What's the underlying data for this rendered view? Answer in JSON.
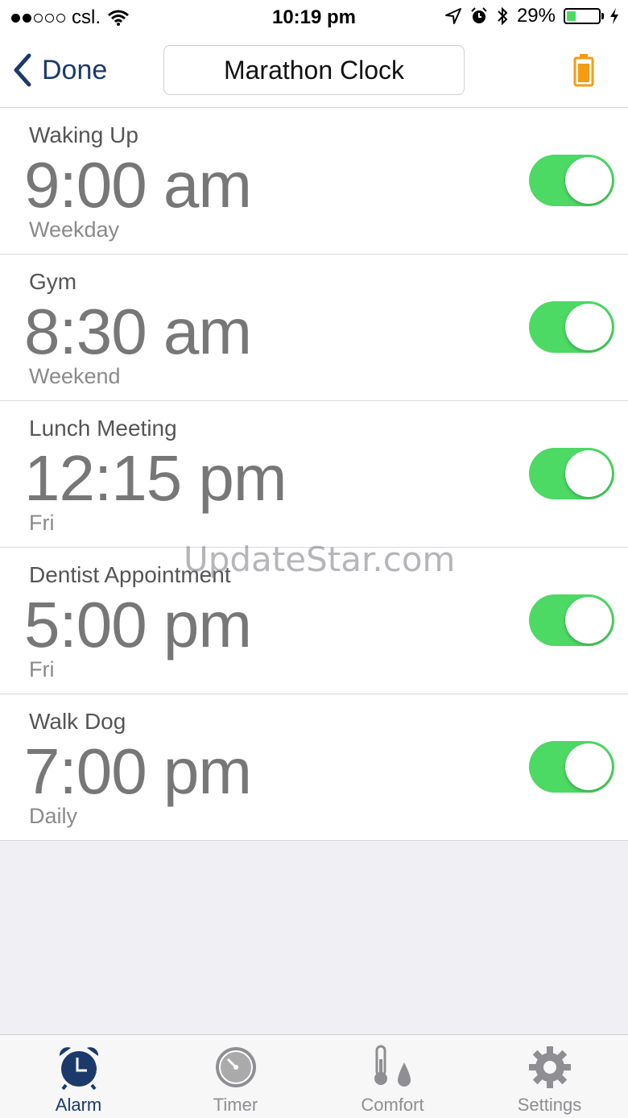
{
  "status_bar": {
    "carrier": "csl.",
    "time": "10:19 pm",
    "battery_percent": "29%",
    "battery_level": 0.29,
    "signal_bars": 2
  },
  "nav": {
    "back_label": "Done",
    "title": "Marathon Clock",
    "accent_color": "#1b3a6b",
    "battery_button_color": "#f39c12"
  },
  "alarms": [
    {
      "label": "Waking Up",
      "time": "9:00 am",
      "repeat": "Weekday",
      "enabled": true
    },
    {
      "label": "Gym",
      "time": "8:30 am",
      "repeat": "Weekend",
      "enabled": true
    },
    {
      "label": "Lunch Meeting",
      "time": "12:15 pm",
      "repeat": "Fri",
      "enabled": true
    },
    {
      "label": "Dentist Appointment",
      "time": "5:00 pm",
      "repeat": "Fri",
      "enabled": true
    },
    {
      "label": "Walk Dog",
      "time": "7:00 pm",
      "repeat": "Daily",
      "enabled": true
    }
  ],
  "watermark": "UpdateStar.com",
  "tabs": [
    {
      "label": "Alarm",
      "icon": "alarm-clock-icon",
      "active": true
    },
    {
      "label": "Timer",
      "icon": "timer-icon",
      "active": false
    },
    {
      "label": "Comfort",
      "icon": "thermometer-drop-icon",
      "active": false
    },
    {
      "label": "Settings",
      "icon": "gear-icon",
      "active": false
    }
  ]
}
